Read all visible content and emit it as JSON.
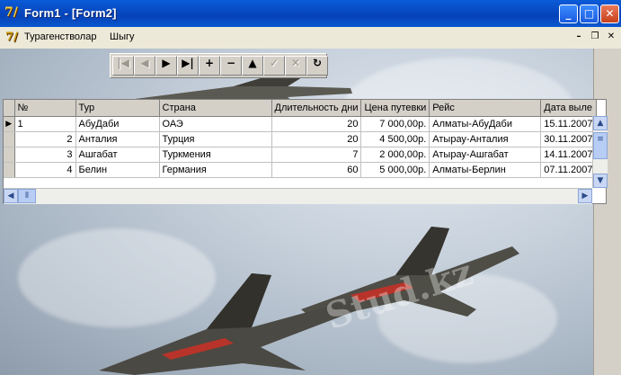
{
  "window": {
    "title": "Form1 - [Form2]",
    "buttons": {
      "minimize": "_",
      "maximize": "□",
      "close": "✕"
    }
  },
  "menu": {
    "items": [
      "Турагенстволар",
      "Шыгу"
    ],
    "mdi_controls": {
      "minimize": "–",
      "restore": "❐",
      "close": "✕"
    }
  },
  "navigator": {
    "buttons": [
      {
        "name": "first",
        "glyph": "|◀",
        "enabled": false
      },
      {
        "name": "prior",
        "glyph": "◀",
        "enabled": false
      },
      {
        "name": "next",
        "glyph": "▶",
        "enabled": true
      },
      {
        "name": "last",
        "glyph": "▶|",
        "enabled": true
      },
      {
        "name": "insert",
        "glyph": "+",
        "enabled": true
      },
      {
        "name": "delete",
        "glyph": "−",
        "enabled": true
      },
      {
        "name": "edit",
        "glyph": "▲",
        "enabled": true
      },
      {
        "name": "post",
        "glyph": "✓",
        "enabled": false
      },
      {
        "name": "cancel",
        "glyph": "✕",
        "enabled": false
      },
      {
        "name": "refresh",
        "glyph": "↻",
        "enabled": true
      }
    ]
  },
  "grid": {
    "columns": [
      "№",
      "Тур",
      "Страна",
      "Длительность дни",
      "Цена путевки",
      "Рейс",
      "Дата выле"
    ],
    "rows": [
      [
        "1",
        "АбуДаби",
        "ОАЭ",
        "20",
        "7 000,00р.",
        "Алматы-АбуДаби",
        "15.11.2007"
      ],
      [
        "2",
        "Анталия",
        "Турция",
        "20",
        "4 500,00р.",
        "Атырау-Анталия",
        "30.11.2007"
      ],
      [
        "3",
        "Ашгабат",
        "Туркмения",
        "7",
        "2 000,00р.",
        "Атырау-Ашгабат",
        "14.11.2007"
      ],
      [
        "4",
        "Белин",
        "Германия",
        "60",
        "5 000,00р.",
        "Алматы-Берлин",
        "07.11.2007"
      ]
    ],
    "current_row": 0
  },
  "watermark": "Stud.kz",
  "icons": [
    "app-icon",
    "form-icon",
    "record-indicator-icon"
  ]
}
